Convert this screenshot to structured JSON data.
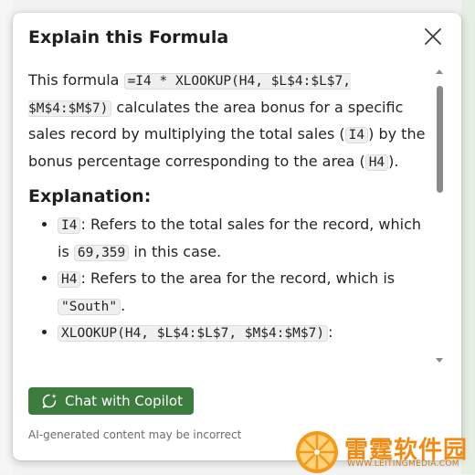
{
  "panel": {
    "title": "Explain this Formula",
    "close_icon": "close-icon"
  },
  "intro": {
    "t1": "This formula ",
    "formula": "=I4 * XLOOKUP(H4, $L$4:$L$7, $M$4:$M$7)",
    "t2": " calculates the area bonus for a specific sales record by multiplying the total sales (",
    "c1": "I4",
    "t3": ") by the bonus percentage corresponding to the area (",
    "c2": "H4",
    "t4": ")."
  },
  "explanation": {
    "heading": "Explanation:",
    "items": [
      {
        "code": "I4",
        "text": ": Refers to the total sales for the record, which is ",
        "code2": "69,359",
        "text2": " in this case."
      },
      {
        "code": "H4",
        "text": ": Refers to the area for the record, which is ",
        "code2": "\"South\"",
        "text2": "."
      },
      {
        "code": "XLOOKUP(H4, $L$4:$L$7, $M$4:$M$7)",
        "text": ":"
      }
    ]
  },
  "footer": {
    "chat_button": "Chat with Copilot",
    "disclaimer": "AI-generated content may be incorrect"
  },
  "watermark": {
    "name": "雷霆软件园",
    "url": "WWW.LEITINGMEDIA.COM"
  },
  "colors": {
    "button": "#3c7d3f",
    "watermark": "#f08a12"
  }
}
